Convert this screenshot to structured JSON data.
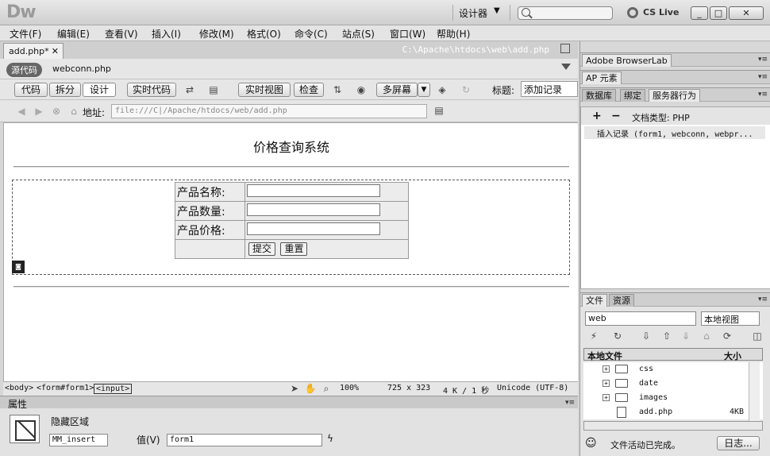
{
  "app": {
    "logo": "Dw",
    "workspace": "设计器",
    "search_placeholder": "",
    "cslive": "CS Live"
  },
  "window_buttons": [
    "_",
    "□",
    "✕"
  ],
  "menu": [
    "文件(F)",
    "编辑(E)",
    "查看(V)",
    "插入(I)",
    "修改(M)",
    "格式(O)",
    "命令(C)",
    "站点(S)",
    "窗口(W)",
    "帮助(H)"
  ],
  "doc": {
    "tab": "add.php*",
    "path": "C:\\Apache\\htdocs\\web\\add.php",
    "source_badge": "源代码",
    "related_file": "webconn.php"
  },
  "toolbar": {
    "code": "代码",
    "split": "拆分",
    "design": "设计",
    "live_code": "实时代码",
    "live_view": "实时视图",
    "inspect": "检查",
    "multiscreen": "多屏幕",
    "title_label": "标题:",
    "title_value": "添加记录"
  },
  "address": {
    "label": "地址:",
    "value": "file:///C|/Apache/htdocs/web/add.php"
  },
  "page": {
    "heading": "价格查询系统",
    "rows": [
      {
        "label": "产品名称:"
      },
      {
        "label": "产品数量:"
      },
      {
        "label": "产品价格:"
      }
    ],
    "submit": "提交",
    "reset": "重置"
  },
  "status": {
    "tags": [
      "<body>",
      "<form#form1>",
      "<input>"
    ],
    "zoom": "100%",
    "size": "725 x 323",
    "download": "4 K / 1 秒",
    "encoding": "Unicode (UTF-8)"
  },
  "properties": {
    "title": "属性",
    "type": "隐藏区域",
    "name_value": "MM_insert",
    "value_label": "值(V)",
    "value": "form1"
  },
  "right": {
    "browserlab": "Adobe BrowserLab",
    "ap": "AP 元素",
    "tabs": [
      "数据库",
      "绑定",
      "服务器行为"
    ],
    "plus": "+",
    "minus": "−",
    "doctype": "文档类型: PHP",
    "behavior": "插入记录 (form1, webconn, webpr...",
    "file_tabs": [
      "文件",
      "资源"
    ],
    "site": "web",
    "view": "本地视图",
    "col_local": "本地文件",
    "col_size": "大小",
    "files": [
      {
        "name": "css",
        "size": "",
        "type": "folder"
      },
      {
        "name": "date",
        "size": "",
        "type": "folder"
      },
      {
        "name": "images",
        "size": "",
        "type": "folder"
      },
      {
        "name": "add.php",
        "size": "4KB",
        "type": "file"
      }
    ],
    "activity": "文件活动已完成。",
    "log": "日志..."
  }
}
